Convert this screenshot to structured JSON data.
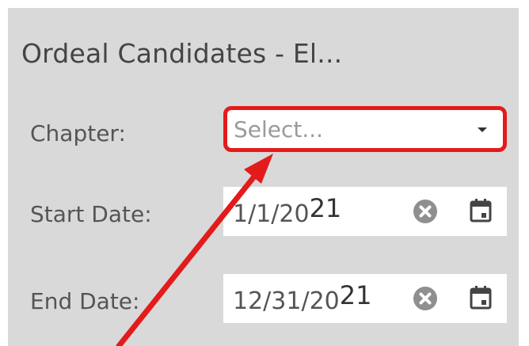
{
  "panel": {
    "title": "Ordeal Candidates - El..."
  },
  "filters": {
    "chapter": {
      "label": "Chapter:",
      "placeholder": "Select..."
    },
    "start_date": {
      "label": "Start Date:",
      "value_main": "1/1/20",
      "value_tail": "21"
    },
    "end_date": {
      "label": "End Date:",
      "value_main": "12/31/20",
      "value_tail": "21"
    }
  },
  "icons": {
    "dropdown": "chevron-down-icon",
    "clear": "clear-circle-x-icon",
    "calendar": "calendar-icon"
  },
  "colors": {
    "highlight": "#e31b1b",
    "panel_bg": "#d9d9d9",
    "icon_gray": "#8f8f8f",
    "annotation_arrow": "#e31b1b"
  }
}
